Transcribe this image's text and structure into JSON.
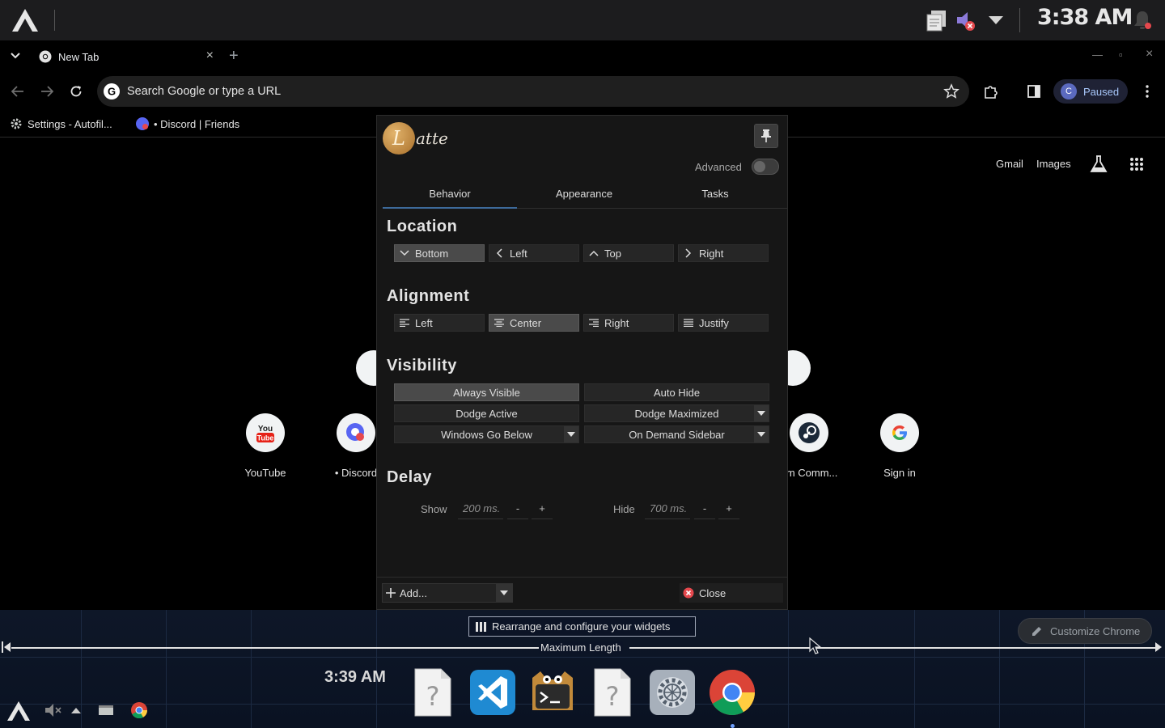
{
  "system_panel": {
    "clock": "3:38 AM",
    "icons": [
      "clipboard-icon",
      "volume-muted-icon",
      "tray-expand-icon",
      "notification-bell-icon"
    ]
  },
  "browser": {
    "tab": {
      "title": "New Tab",
      "close": "×"
    },
    "new_tab": "+",
    "window_controls": {
      "minimize": "—",
      "restore": "▫",
      "close": "×"
    },
    "omnibox": {
      "placeholder": "Search Google or type a URL"
    },
    "profile": {
      "initial": "C",
      "label": "Paused"
    },
    "bookmarks": [
      {
        "label": "Settings - Autofil..."
      },
      {
        "label": "• Discord | Friends"
      }
    ],
    "ntp": {
      "links": {
        "gmail": "Gmail",
        "images": "Images"
      },
      "shortcuts": [
        {
          "label": "YouTube"
        },
        {
          "label": "• Discord"
        },
        {
          "label": "am Comm..."
        },
        {
          "label": "Sign in"
        }
      ]
    },
    "customize": "Customize Chrome"
  },
  "latte": {
    "logo_letter": "L",
    "logo_word": "atte",
    "advanced_label": "Advanced",
    "advanced_on": false,
    "tabs": [
      "Behavior",
      "Appearance",
      "Tasks"
    ],
    "active_tab": "Behavior",
    "location": {
      "title": "Location",
      "options": [
        "Bottom",
        "Left",
        "Top",
        "Right"
      ],
      "selected": "Bottom"
    },
    "alignment": {
      "title": "Alignment",
      "options": [
        "Left",
        "Center",
        "Right",
        "Justify"
      ],
      "selected": "Center"
    },
    "visibility": {
      "title": "Visibility",
      "options": [
        "Always Visible",
        "Auto Hide",
        "Dodge Active",
        "Dodge Maximized",
        "Windows Go Below",
        "On Demand Sidebar"
      ],
      "selected": "Always Visible"
    },
    "delay": {
      "title": "Delay",
      "show_label": "Show",
      "show_value": "200 ms.",
      "hide_label": "Hide",
      "hide_value": "700 ms.",
      "minus": "-",
      "plus": "+"
    },
    "footer": {
      "add": "Add...",
      "close": "Close"
    }
  },
  "dock": {
    "rearrange": "Rearrange and configure your widgets",
    "max_length": "Maximum Length",
    "clock": "3:39 AM",
    "apps": [
      "unknown-file-icon",
      "vscode-icon",
      "terminal-cat-icon",
      "unknown-file-icon",
      "system-settings-icon",
      "chrome-icon"
    ]
  },
  "colors": {
    "accent_tab": "#3d6a9a",
    "chrome_blue": "#a8c7fa",
    "close_red": "#e5484d"
  }
}
